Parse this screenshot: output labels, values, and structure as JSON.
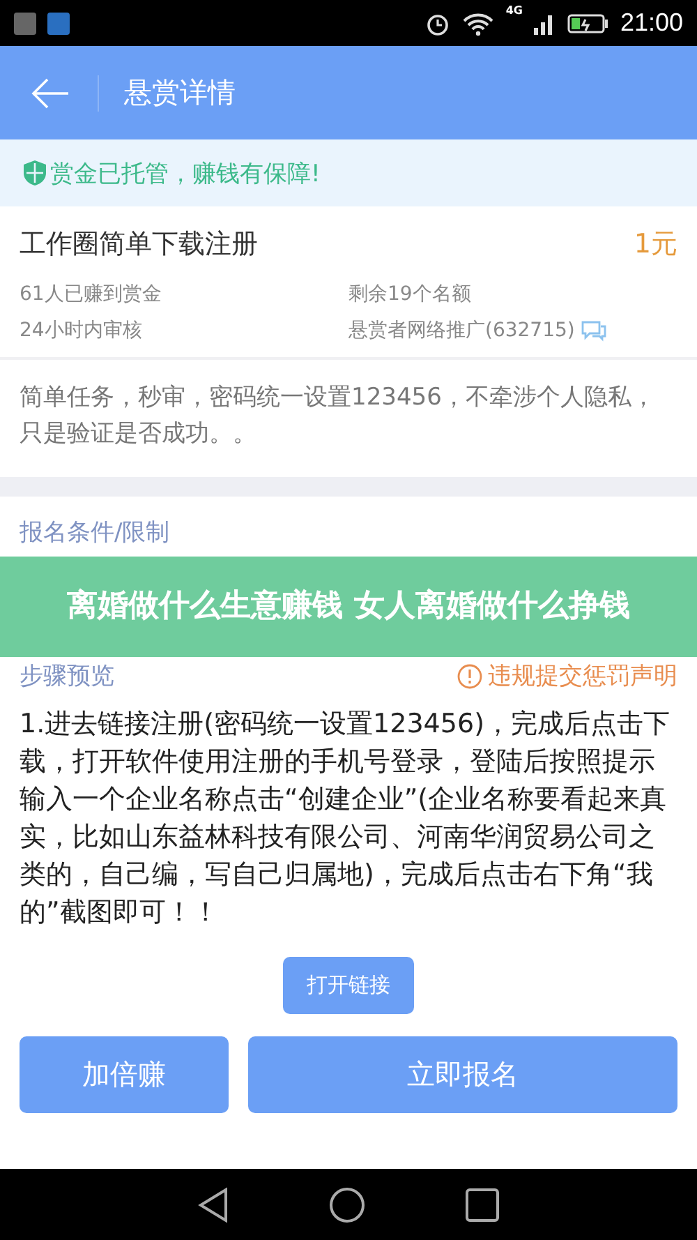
{
  "status_bar": {
    "time": "21:00",
    "network": "4G"
  },
  "header": {
    "title": "悬赏详情"
  },
  "notice": {
    "text": "赏金已托管，赚钱有保障!"
  },
  "task": {
    "title": "工作圈简单下载注册",
    "reward": "1元",
    "earned": "61人已赚到赏金",
    "remaining": "剩余19个名额",
    "review": "24小时内审核",
    "publisher": "悬赏者网络推广(632715)"
  },
  "description": "简单任务，秒审，密码统一设置123456，不牵涉个人隐私，只是验证是否成功。。",
  "conditions": {
    "title": "报名条件/限制"
  },
  "steps": {
    "title": "步骤预览",
    "penalty_link": "违规提交惩罚声明",
    "text": "1.进去链接注册(密码统一设置123456)，完成后点击下载，打开软件使用注册的手机号登录，登陆后按照提示输入一个企业名称点击“创建企业”(企业名称要看起来真实，比如山东益林科技有限公司、河南华润贸易公司之类的，自己编，写自己归属地)，完成后点击右下角“我的”截图即可！！",
    "open_link": "打开链接"
  },
  "actions": [
    "加倍赚",
    "立即报名"
  ],
  "banner": {
    "text": "离婚做什么生意赚钱 女人离婚做什么挣钱"
  }
}
